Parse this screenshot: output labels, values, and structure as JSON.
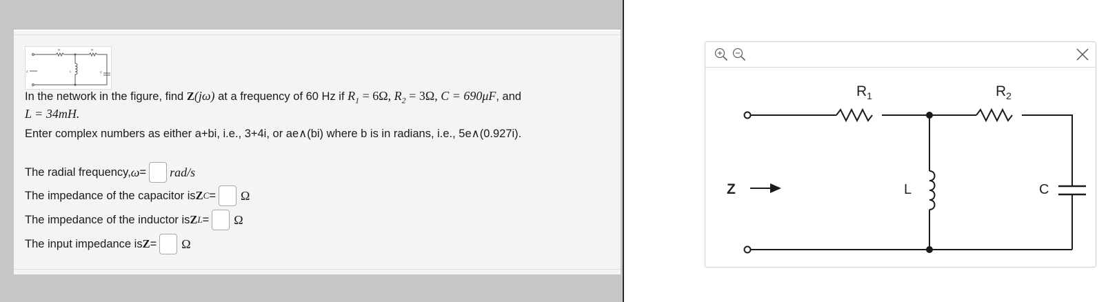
{
  "question": {
    "problem_intro": "In the network in the figure, find ",
    "problem_target": "Z",
    "problem_target_arg": "(jω)",
    "problem_freq": " at a frequency of 60 Hz if ",
    "r1_var": "R",
    "r1_sub": "1",
    "r1_val": " = 6Ω, ",
    "r2_var": "R",
    "r2_sub": "2",
    "r2_val": " = 3Ω, ",
    "c_val": "C = 690μF",
    "and_text": ", and",
    "l_val": "L = 34mH.",
    "instructions": "Enter complex numbers as either a+bi, i.e., 3+4i, or ae∧(bi) where b is in radians, i.e., 5e∧(0.927i)."
  },
  "answers": {
    "omega": {
      "label": "The radial frequency, ",
      "var": "ω",
      "eq": " =",
      "value": "",
      "unit": "rad/s"
    },
    "zc": {
      "label": "The impedance of the capacitor is ",
      "var": "Z",
      "sub": "C",
      "eq": " =",
      "value": "",
      "unit": "Ω"
    },
    "zl": {
      "label": "The impedance of the inductor is ",
      "var": "Z",
      "sub": "L",
      "eq": " =",
      "value": "",
      "unit": "Ω"
    },
    "z": {
      "label": "The input impedance is ",
      "var": "Z",
      "eq": " =",
      "value": "",
      "unit": "Ω"
    }
  },
  "figure": {
    "r1_letter": "R",
    "r1_sub": "1",
    "r2_letter": "R",
    "r2_sub": "2",
    "l_label": "L",
    "c_label": "C",
    "z_label": "Z"
  },
  "viewer": {
    "zoom_in_icon": "zoom-in-icon",
    "zoom_out_icon": "zoom-out-icon",
    "close_icon": "close-icon"
  },
  "colors": {
    "backdrop": "#c6c6c6",
    "panel": "#f4f4f4",
    "divider": "#2b2b2b",
    "wire": "#1a1a1a"
  }
}
